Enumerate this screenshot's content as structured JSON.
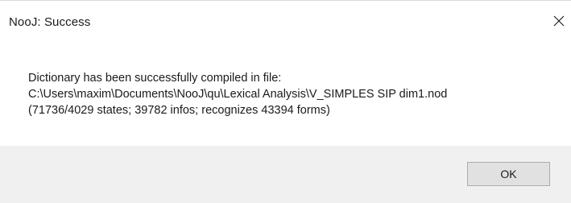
{
  "window": {
    "title": "NooJ: Success",
    "close_icon": "close-icon"
  },
  "message": {
    "line1": "Dictionary has been successfully compiled in file:",
    "line2": "C:\\Users\\maxim\\Documents\\NooJ\\qu\\Lexical Analysis\\V_SIMPLES SIP dim1.nod",
    "line3": "(71736/4029 states; 39782 infos; recognizes 43394 forms)"
  },
  "buttons": {
    "ok_label": "OK"
  },
  "colors": {
    "footer_bg": "#f0f0f0",
    "button_bg": "#e1e1e1",
    "button_border": "#adadad"
  }
}
